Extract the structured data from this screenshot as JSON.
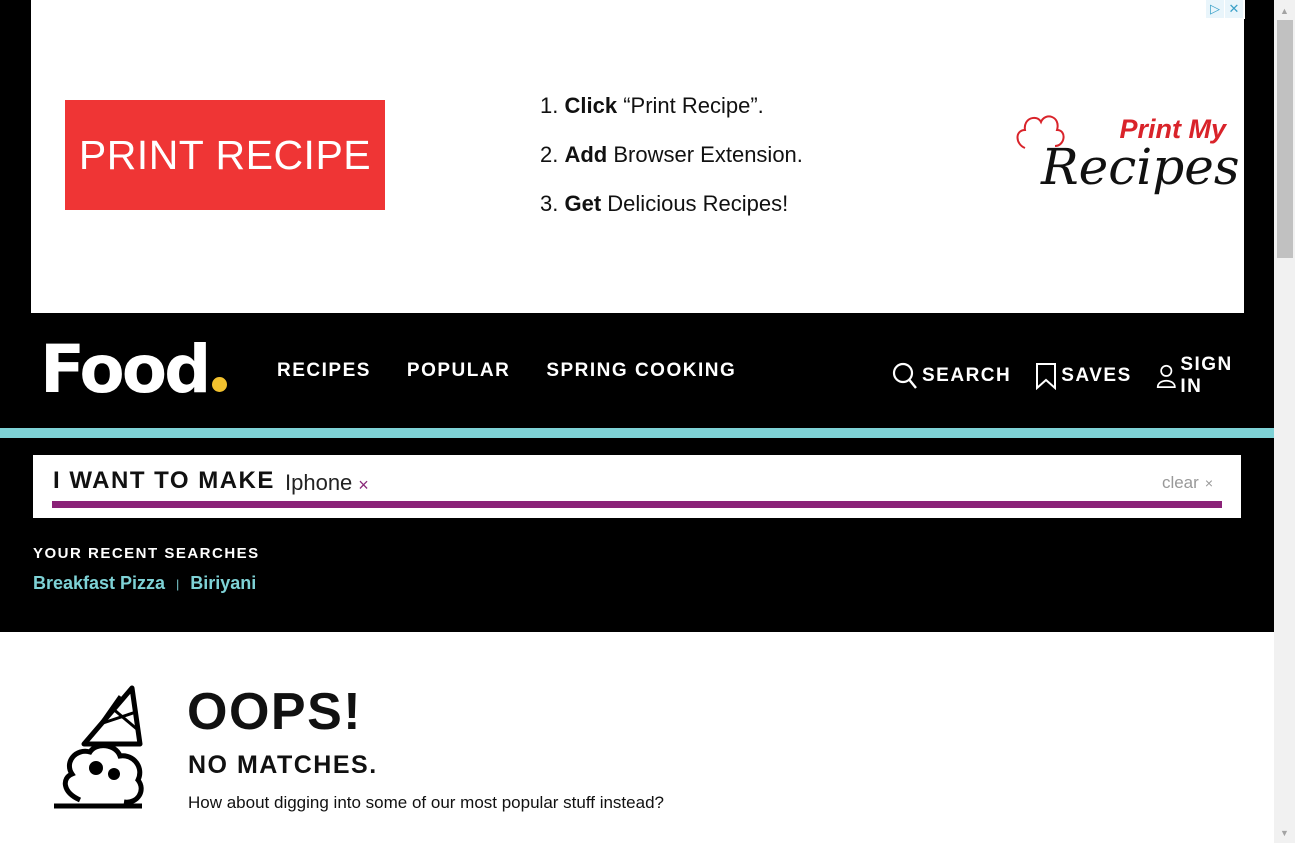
{
  "ad": {
    "button_label": "PRINT RECIPE",
    "steps": [
      {
        "num": "1.",
        "bold": "Click",
        "rest": "“Print Recipe”."
      },
      {
        "num": "2.",
        "bold": "Add",
        "rest": "Browser Extension."
      },
      {
        "num": "3.",
        "bold": "Get",
        "rest": "Delicious Recipes!"
      }
    ],
    "logo_top": "Print My",
    "logo_bottom": "Recipes",
    "adchoices_icon": "▷",
    "close_icon": "✕"
  },
  "header": {
    "logo": "Food",
    "nav": [
      "RECIPES",
      "POPULAR",
      "SPRING COOKING"
    ],
    "search": "SEARCH",
    "saves": "SAVES",
    "signin": "SIGN IN"
  },
  "search": {
    "label": "I WANT TO MAKE",
    "term": "Iphone",
    "term_remove": "×",
    "clear": "clear",
    "clear_icon": "×"
  },
  "recent": {
    "title": "YOUR RECENT SEARCHES",
    "items": [
      "Breakfast Pizza",
      "Biriyani"
    ],
    "separator": "|"
  },
  "results": {
    "title": "OOPS!",
    "subtitle": "NO MATCHES.",
    "message": "How about digging into some of our most popular stuff instead?"
  },
  "colors": {
    "accent_teal": "#7ed2d6",
    "accent_purple": "#8b2278",
    "logo_dot": "#f2c12e",
    "ad_red": "#ef3535"
  }
}
